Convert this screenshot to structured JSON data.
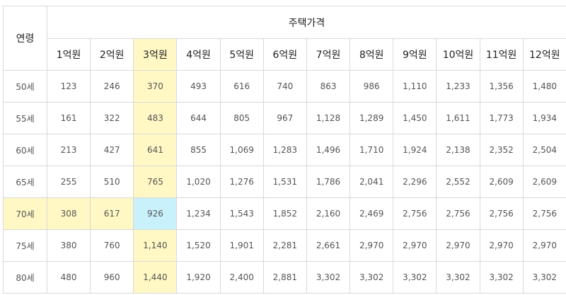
{
  "table": {
    "age_header": "연령",
    "price_header": "주택가격",
    "prices": [
      "1억원",
      "2억원",
      "3억원",
      "4억원",
      "5억원",
      "6억원",
      "7억원",
      "8억원",
      "9억원",
      "10억원",
      "11억원",
      "12억원"
    ],
    "rows": [
      {
        "age": "50세",
        "values": [
          "123",
          "246",
          "370",
          "493",
          "616",
          "740",
          "863",
          "986",
          "1,110",
          "1,233",
          "1,356",
          "1,480"
        ]
      },
      {
        "age": "55세",
        "values": [
          "161",
          "322",
          "483",
          "644",
          "805",
          "967",
          "1,128",
          "1,289",
          "1,450",
          "1,611",
          "1,773",
          "1,934"
        ]
      },
      {
        "age": "60세",
        "values": [
          "213",
          "427",
          "641",
          "855",
          "1,069",
          "1,283",
          "1,496",
          "1,710",
          "1,924",
          "2,138",
          "2,352",
          "2,504"
        ]
      },
      {
        "age": "65세",
        "values": [
          "255",
          "510",
          "765",
          "1,020",
          "1,276",
          "1,531",
          "1,786",
          "2,041",
          "2,296",
          "2,552",
          "2,609",
          "2,609"
        ]
      },
      {
        "age": "70세",
        "values": [
          "308",
          "617",
          "926",
          "1,234",
          "1,543",
          "1,852",
          "2,160",
          "2,469",
          "2,756",
          "2,756",
          "2,756",
          "2,756"
        ]
      },
      {
        "age": "75세",
        "values": [
          "380",
          "760",
          "1,140",
          "1,520",
          "1,901",
          "2,281",
          "2,661",
          "2,970",
          "2,970",
          "2,970",
          "2,970",
          "2,970"
        ]
      },
      {
        "age": "80세",
        "values": [
          "480",
          "960",
          "1,440",
          "1,920",
          "2,400",
          "2,881",
          "3,302",
          "3,302",
          "3,302",
          "3,302",
          "3,302",
          "3,302"
        ]
      }
    ],
    "highlight": {
      "column_index": 2,
      "row_index": 4
    },
    "colors": {
      "highlight": "#fff8c4",
      "crosshair": "#c8f1fb",
      "border": "#d9d9d9"
    }
  }
}
